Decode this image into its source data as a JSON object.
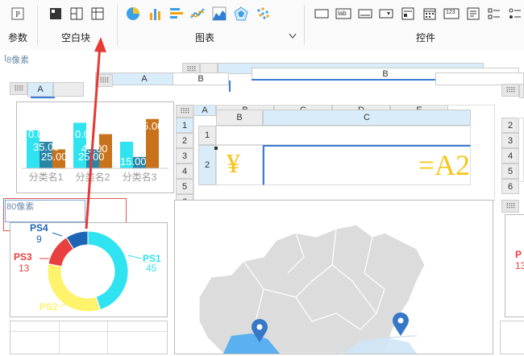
{
  "toolbar": {
    "groups": {
      "params": "参数",
      "blank": "空白块",
      "chart": "图表",
      "widget": "控件"
    },
    "widget_icons": {
      "label": "lab",
      "number": "123"
    },
    "chart_expand_icon": "chevron-down-icon"
  },
  "canvas": {
    "top_px_label": "8像素",
    "sel_px_label": "80像素",
    "grid_top": {
      "col_a": "A",
      "col_b": "B",
      "col_b2": "B"
    },
    "grid_left": {
      "col_a": "A"
    },
    "grid_main": {
      "cols": [
        "A",
        "B",
        "C",
        "D",
        "E"
      ],
      "rows": [
        "1",
        "2",
        "3",
        "4",
        "5",
        "6"
      ]
    },
    "grid_inner": {
      "col_b": "B",
      "col_c": "C",
      "rows": [
        "1",
        "2"
      ],
      "yen": "¥",
      "formula": "=A2"
    },
    "grid_right": {
      "rows": [
        "2",
        "3",
        "4",
        "5",
        "6"
      ]
    },
    "right_partial_text": "P",
    "right_partial_num": "13"
  },
  "colors": {
    "accent": "#3a7bd5",
    "arrow": "#e53935",
    "cyan": "#2fe3f0",
    "teal": "#2a86a8",
    "orange": "#c8731b",
    "red": "#e84040",
    "yellow": "#fff36b",
    "blue": "#1e64b4"
  },
  "chart_data": [
    {
      "type": "bar",
      "categories": [
        "分类名1",
        "分类名2",
        "分类名3"
      ],
      "series": [
        {
          "values": [
            50,
            60,
            35
          ]
        },
        {
          "values": [
            35,
            25,
            15
          ]
        },
        {
          "values": [
            25,
            45,
            65
          ]
        }
      ],
      "data_labels": [
        "0.00",
        "35.00",
        "25.00",
        "0.00",
        "45.00",
        "25.00",
        "15.00",
        "5.00"
      ],
      "ylim": [
        0,
        70
      ]
    },
    {
      "type": "pie",
      "labels": [
        "PS1",
        "PS2",
        "PS3",
        "PS4"
      ],
      "values": [
        45,
        33,
        13,
        9
      ],
      "value_labels": [
        "45",
        "",
        "13",
        "9"
      ]
    }
  ]
}
